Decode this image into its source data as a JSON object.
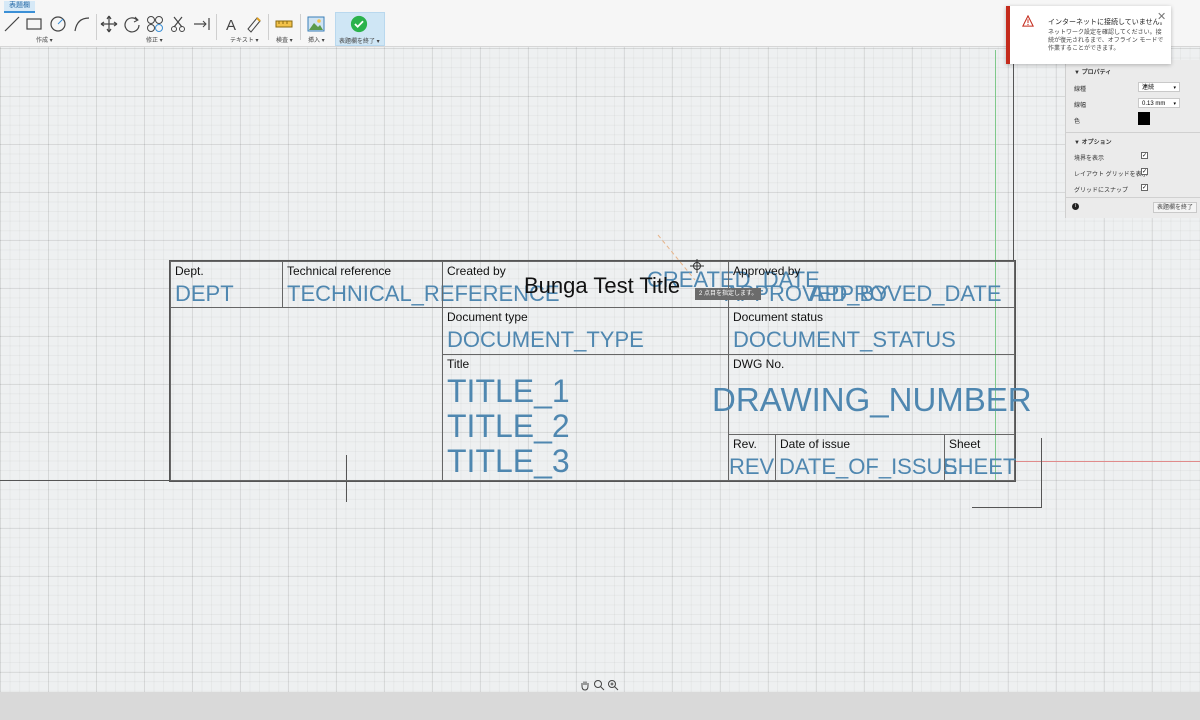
{
  "toolbar": {
    "tab_label": "表題欄",
    "groups": {
      "create": "作成 ▾",
      "modify": "修正 ▾",
      "text": "テキスト ▾",
      "inspect": "検査 ▾",
      "insert": "挿入 ▾",
      "finish": "表題欄を終了 ▾"
    }
  },
  "title_block": {
    "dept": {
      "label": "Dept.",
      "value": "DEPT"
    },
    "technical_reference": {
      "label": "Technical reference",
      "value": "TECHNICAL_REFERENCE"
    },
    "created_by": {
      "label": "Created by",
      "value": "CREATED_DATE"
    },
    "approved_by": {
      "label": "Approved by",
      "value": "APPROVED_BY",
      "date_value": "APPROVED_DATE"
    },
    "overlay_title": "Bunga Test Title",
    "document_type": {
      "label": "Document type",
      "value": "DOCUMENT_TYPE"
    },
    "document_status": {
      "label": "Document status",
      "value": "DOCUMENT_STATUS"
    },
    "title": {
      "label": "Title",
      "lines": [
        "TITLE_1",
        "TITLE_2",
        "TITLE_3"
      ]
    },
    "dwg_no": {
      "label": "DWG No.",
      "value": "DRAWING_NUMBER"
    },
    "rev": {
      "label": "Rev.",
      "value": "REV"
    },
    "date_of_issue": {
      "label": "Date of issue",
      "value": "DATE_OF_ISSUE"
    },
    "sheet": {
      "label": "Sheet",
      "value": "SHEET"
    }
  },
  "cursor_tooltip": "2 点目を指定します。",
  "properties_panel": {
    "properties_header": "▼ プロパティ",
    "linetype_label": "線種",
    "linetype_value": "連続",
    "lineweight_label": "線幅",
    "lineweight_value": "0.13 mm",
    "color_label": "色",
    "color_value": "#000000",
    "options_header": "▼ オプション",
    "show_border_label": "境界を表示",
    "show_layout_grid_label": "レイアウト グリッドを表示",
    "snap_to_grid_label": "グリッドにスナップ",
    "finish_button": "表題欄を終了"
  },
  "notification": {
    "title": "インターネットに接続していません。",
    "body": "ネットワーク設定を確認してください。接続が復元されるまで、オフライン モードで作業することができます。"
  },
  "colors": {
    "field_text": "#4f87b0",
    "accent": "#3a8fd6",
    "error": "#c42b1c",
    "finish_check": "#2bb24c"
  }
}
